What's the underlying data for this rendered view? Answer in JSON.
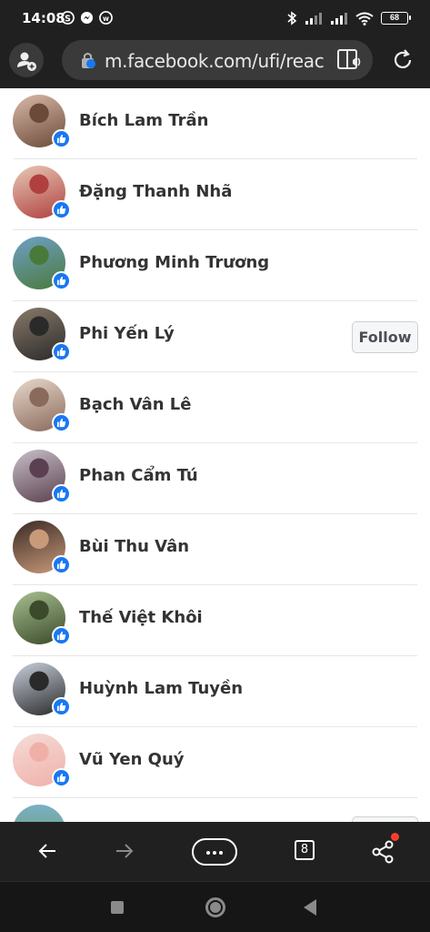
{
  "status_bar": {
    "time": "14:08",
    "battery": "68",
    "icons": [
      "skype-icon",
      "messenger-icon",
      "w-app-icon",
      "bluetooth-icon",
      "signal-icon",
      "signal-icon",
      "wifi-icon",
      "battery-icon"
    ]
  },
  "browser": {
    "url": "m.facebook.com/ufi/reactio",
    "tab_count": "8",
    "accent": "#1877f2"
  },
  "reactions": [
    {
      "name": "Bích Lam Trần",
      "reaction": "like",
      "follow": false
    },
    {
      "name": "Đặng Thanh Nhã",
      "reaction": "like",
      "follow": false
    },
    {
      "name": "Phương Minh Trương",
      "reaction": "like",
      "follow": false
    },
    {
      "name": "Phi Yến Lý",
      "reaction": "like",
      "follow": true
    },
    {
      "name": "Bạch Vân Lê",
      "reaction": "like",
      "follow": false
    },
    {
      "name": "Phan Cẩm Tú",
      "reaction": "like",
      "follow": false
    },
    {
      "name": "Bùi Thu Vân",
      "reaction": "like",
      "follow": false
    },
    {
      "name": "Thế Việt Khôi",
      "reaction": "like",
      "follow": false
    },
    {
      "name": "Huỳnh Lam Tuyền",
      "reaction": "like",
      "follow": false
    },
    {
      "name": "Vũ Yen Quý",
      "reaction": "like",
      "follow": false
    }
  ],
  "follow_label": "Follow"
}
